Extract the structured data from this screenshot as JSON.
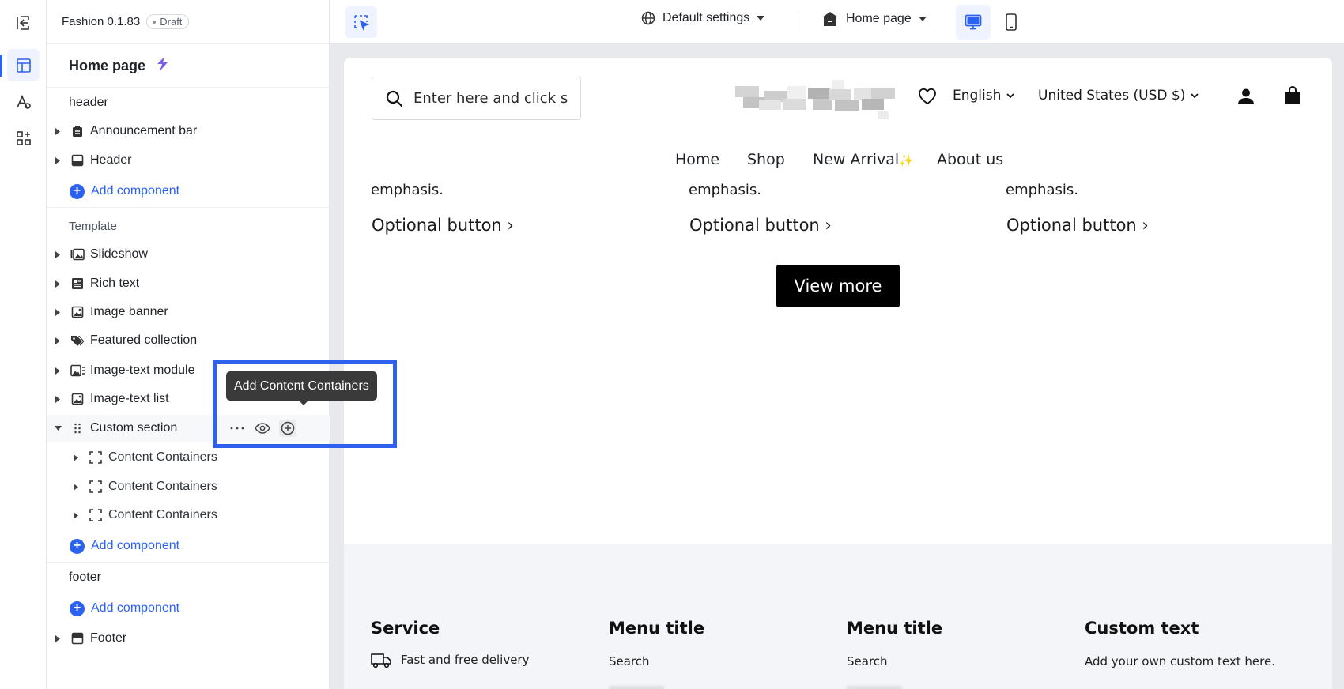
{
  "app": {
    "name": "Fashion 0.1.83",
    "status_badge": "Draft"
  },
  "rail": {
    "icons": [
      "layout-icon",
      "theme-style-icon",
      "apps-icon"
    ]
  },
  "panel": {
    "page_title": "Home page",
    "groups": {
      "header": "header",
      "template": "Template",
      "footer": "footer"
    },
    "header_items": [
      {
        "label": "Announcement bar",
        "icon": "clipboard-icon"
      },
      {
        "label": "Header",
        "icon": "header-block-icon"
      }
    ],
    "template_items": [
      {
        "label": "Slideshow",
        "icon": "slideshow-icon"
      },
      {
        "label": "Rich text",
        "icon": "rich-text-icon"
      },
      {
        "label": "Image banner",
        "icon": "image-icon"
      },
      {
        "label": "Featured collection",
        "icon": "tag-icon"
      },
      {
        "label": "Image-text module",
        "icon": "image-text-icon"
      },
      {
        "label": "Image-text list",
        "icon": "image-icon"
      },
      {
        "label": "Custom section",
        "icon": "drag-handle-icon"
      }
    ],
    "custom_children": [
      {
        "label": "Content Containers"
      },
      {
        "label": "Content Containers"
      },
      {
        "label": "Content Containers"
      }
    ],
    "footer_items": [
      {
        "label": "Footer",
        "icon": "footer-block-icon"
      }
    ],
    "add_component": "Add component",
    "tooltip": "Add Content Containers"
  },
  "toolbar": {
    "settings_label": "Default settings",
    "page_label": "Home page"
  },
  "preview": {
    "search_placeholder": "Enter here and click search",
    "language": "English",
    "currency": "United States (USD $)",
    "nav": [
      "Home",
      "Shop",
      "New Arrival",
      "About us"
    ],
    "nav_sparkle": "✨",
    "columns": [
      {
        "text": "emphasis.",
        "button": "Optional button ›"
      },
      {
        "text": "emphasis.",
        "button": "Optional button ›"
      },
      {
        "text": "emphasis.",
        "button": "Optional button ›"
      }
    ],
    "view_more": "View more",
    "footer": {
      "service_title": "Service",
      "service_item": "Fast and free delivery",
      "menu1_title": "Menu title",
      "menu1_item": "Search",
      "menu2_title": "Menu title",
      "menu2_item": "Search",
      "custom_title": "Custom text",
      "custom_body": "Add your own custom text here."
    }
  },
  "colors": {
    "accent": "#2b63f0",
    "highlight_box": "#2e62ee",
    "tooltip_bg": "#3a3a3a"
  }
}
